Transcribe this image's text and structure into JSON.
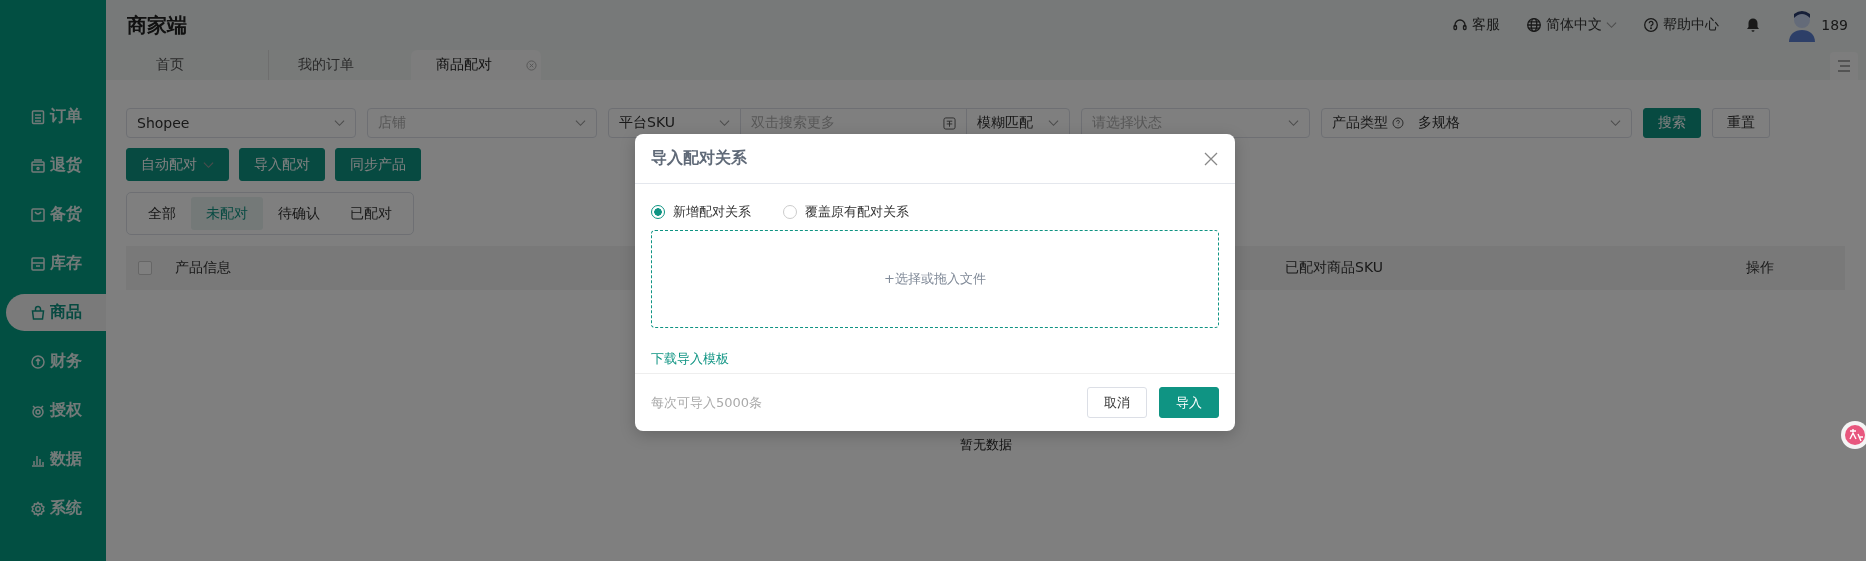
{
  "app": {
    "title": "商家端"
  },
  "header": {
    "items": [
      {
        "kind": "support",
        "label": "客服",
        "dropdown": false
      },
      {
        "kind": "language",
        "label": "简体中文",
        "dropdown": true
      },
      {
        "kind": "help",
        "label": "帮助中心",
        "dropdown": false
      }
    ],
    "user": {
      "name": "189"
    }
  },
  "tabs": [
    {
      "label": "首页",
      "selected": false,
      "closable": false
    },
    {
      "label": "我的订单",
      "selected": false,
      "closable": false
    },
    {
      "label": "商品配对",
      "selected": true,
      "closable": true
    }
  ],
  "sidebar": {
    "items": [
      {
        "label": "订单",
        "selected": false
      },
      {
        "label": "退货",
        "selected": false
      },
      {
        "label": "备货",
        "selected": false
      },
      {
        "label": "库存",
        "selected": false
      },
      {
        "label": "商品",
        "selected": true
      },
      {
        "label": "财务",
        "selected": false
      },
      {
        "label": "授权",
        "selected": false
      },
      {
        "label": "数据",
        "selected": false
      },
      {
        "label": "系统",
        "selected": false
      }
    ]
  },
  "filters": [
    {
      "kind": "select",
      "value": "Shopee"
    },
    {
      "kind": "select",
      "placeholder": "店铺"
    },
    {
      "kind": "combo",
      "select": "平台SKU",
      "placeholder": "双击搜索更多",
      "mode": "模糊匹配"
    },
    {
      "kind": "select",
      "placeholder": "请选择状态"
    },
    {
      "kind": "labeled",
      "label": "产品类型",
      "value": "多规格"
    }
  ],
  "filter_buttons": [
    {
      "label": "搜索",
      "primary": true
    },
    {
      "label": "重置",
      "primary": false
    }
  ],
  "actions": [
    {
      "label": "自动配对",
      "dropdown": true
    },
    {
      "label": "导入配对",
      "dropdown": false
    },
    {
      "label": "同步产品",
      "dropdown": false
    }
  ],
  "status_tabs": [
    {
      "label": "全部",
      "selected": false
    },
    {
      "label": "未配对",
      "selected": true
    },
    {
      "label": "待确认",
      "selected": false
    },
    {
      "label": "已配对",
      "selected": false
    }
  ],
  "table": {
    "columns": [
      {
        "label": "产品信息"
      },
      {
        "label": "已配对商品SKU"
      },
      {
        "label": "操作"
      }
    ],
    "select_all": false,
    "empty_text": "暂无数据"
  },
  "dialog": {
    "title": "导入配对关系",
    "options": [
      {
        "label": "新增配对关系",
        "selected": true
      },
      {
        "label": "覆盖原有配对关系",
        "selected": false
      }
    ],
    "dropzone": "+选择或拖入文件",
    "template_link": "下载导入模板",
    "note": "每次可导入5000条",
    "buttons": [
      {
        "label": "取消",
        "primary": false
      },
      {
        "label": "导入",
        "primary": true
      }
    ]
  }
}
